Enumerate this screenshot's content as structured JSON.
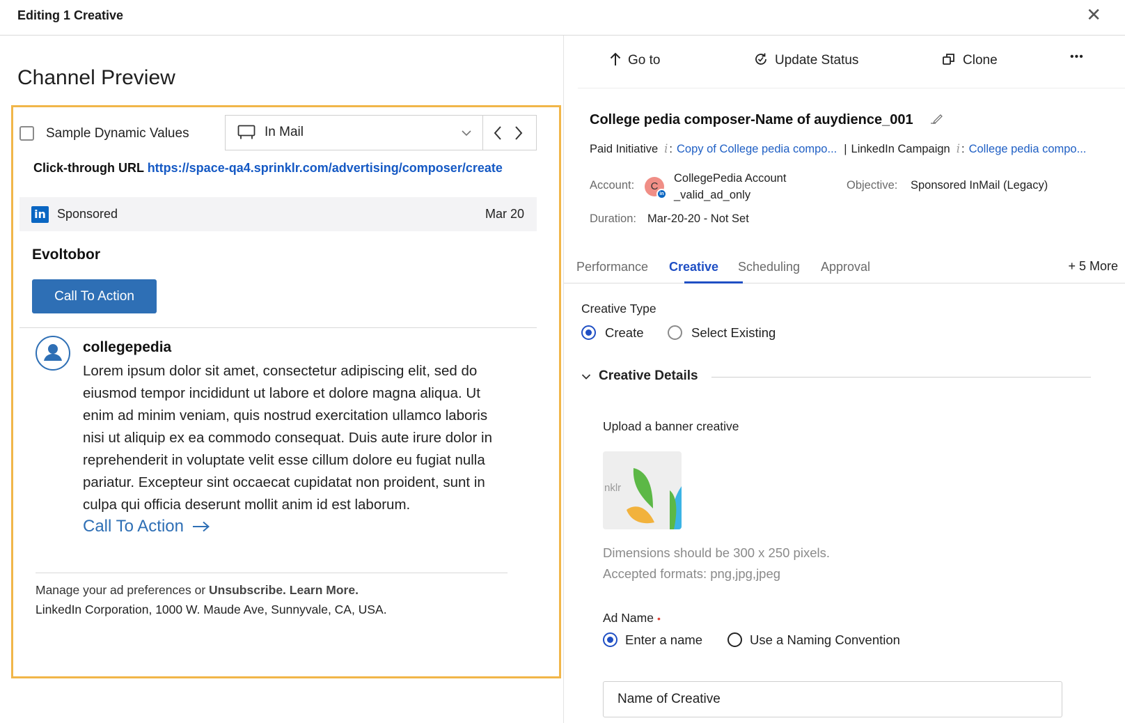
{
  "window": {
    "title": "Editing 1 Creative"
  },
  "left": {
    "heading": "Channel Preview",
    "sample_dynamic_values": "Sample Dynamic Values",
    "placement": "In Mail",
    "click_through_label": "Click-through URL",
    "click_through_url": "https://space-qa4.sprinklr.com/advertising/composer/create",
    "sponsored_label": "Sponsored",
    "date": "Mar 20",
    "brand_name": "Evoltobor",
    "cta_button": "Call To Action",
    "sender": "collegepedia",
    "message": "Lorem ipsum dolor sit amet, consectetur adipiscing elit, sed do eiusmod tempor incididunt ut labore et dolore magna aliqua. Ut enim ad minim veniam, quis nostrud exercitation ullamco laboris nisi ut aliquip ex ea commodo consequat. Duis aute irure dolor in reprehenderit in voluptate velit esse cillum dolore eu fugiat nulla pariatur. Excepteur sint occaecat cupidatat non proident, sunt in culpa qui officia deserunt mollit anim id est laborum.",
    "cta_link": "Call To Action",
    "footer_prefix": "Manage your ad preferences or ",
    "footer_bold": "Unsubscribe. Learn More.",
    "footer_address": "LinkedIn Corporation, 1000 W. Maude Ave, Sunnyvale, CA, USA."
  },
  "toolbar": {
    "goto": "Go to",
    "update_status": "Update Status",
    "clone": "Clone",
    "more": "•••"
  },
  "details": {
    "title": "College pedia composer-Name of auydience_001",
    "paid_initiative_label": "Paid Initiative",
    "paid_initiative_value": "Copy of College pedia compo...",
    "campaign_label": "LinkedIn Campaign",
    "campaign_value": "College pedia compo...",
    "account_label": "Account:",
    "account_initial": "C",
    "account_value": "CollegePedia Account _valid_ad_only",
    "objective_label": "Objective:",
    "objective_value": "Sponsored InMail (Legacy)",
    "duration_label": "Duration:",
    "duration_value": "Mar-20-20 - Not Set"
  },
  "tabs": {
    "items": [
      "Performance",
      "Creative",
      "Scheduling",
      "Approval"
    ],
    "active": "Creative",
    "more": "+ 5 More"
  },
  "creative": {
    "type_label": "Creative Type",
    "opt_create": "Create",
    "opt_select_existing": "Select Existing",
    "selected_type": "Create",
    "section_title": "Creative Details",
    "upload_label": "Upload a banner creative",
    "thumb_text": "nklr",
    "dimensions_note": "Dimensions should be 300 x 250 pixels.",
    "formats_note": "Accepted formats: png,jpg,jpeg",
    "ad_name_label": "Ad Name",
    "ad_name_required": "•",
    "opt_enter_name": "Enter a name",
    "opt_naming_convention": "Use a Naming Convention",
    "selected_naming": "Enter a name",
    "name_value": "Name of Creative"
  },
  "colors": {
    "preview_border": "#f1b649",
    "accent_blue": "#1f4fc4",
    "cta_blue": "#2e6fb5",
    "linkedin": "#0a66c2"
  },
  "icons": [
    "close-icon",
    "inbox-icon",
    "chevron-down-icon",
    "chevron-left-icon",
    "chevron-right-icon",
    "linkedin-icon",
    "user-avatar-icon",
    "arrow-right-icon",
    "arrow-up-icon",
    "refresh-icon",
    "clone-icon",
    "more-icon",
    "pencil-icon",
    "info-icon"
  ]
}
